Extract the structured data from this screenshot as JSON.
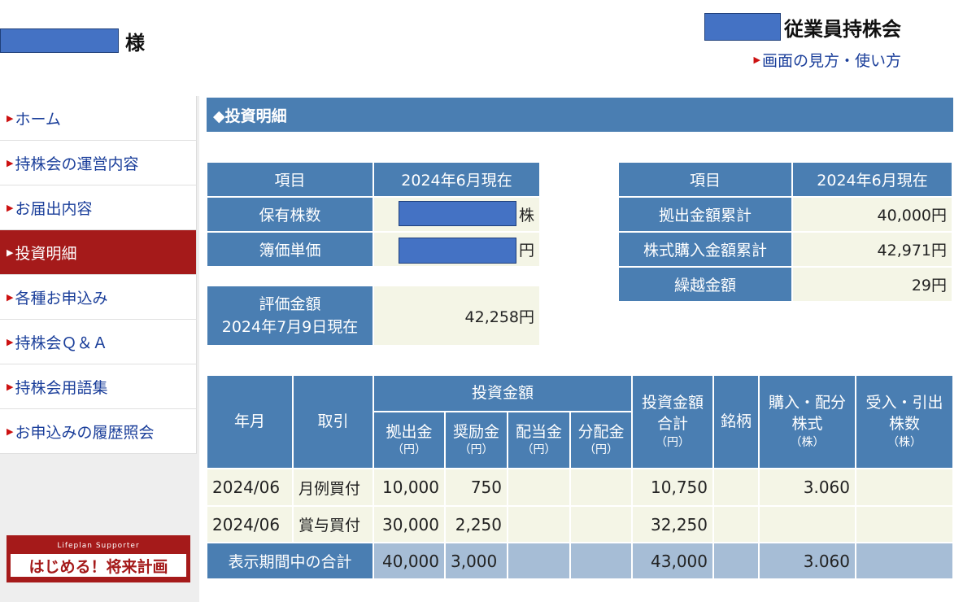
{
  "header": {
    "user_suffix": "様",
    "company_name": "従業員持株会",
    "help_link": "画面の見方・使い方"
  },
  "sidebar": {
    "items": [
      {
        "label": "ホーム"
      },
      {
        "label": "持株会の運営内容"
      },
      {
        "label": "お届出内容"
      },
      {
        "label": "投資明細"
      },
      {
        "label": "各種お申込み"
      },
      {
        "label": "持株会Ｑ＆Ａ"
      },
      {
        "label": "持株会用語集"
      },
      {
        "label": "お申込みの履歴照会"
      }
    ],
    "active_index": 3,
    "banner": {
      "small": "Lifeplan Supporter",
      "main": "はじめる！将来計画"
    }
  },
  "main": {
    "title": "◆投資明細",
    "holdings": {
      "col_item": "項目",
      "col_date": "2024年6月現在",
      "shares_label": "保有株数",
      "shares_unit": "株",
      "price_label": "簿価単価",
      "price_unit": "円"
    },
    "valuation": {
      "label_line1": "評価金額",
      "label_line2": "2024年7月9日現在",
      "value": "42,258円"
    },
    "summary": {
      "col_item": "項目",
      "col_date": "2024年6月現在",
      "rows": [
        {
          "label": "拠出金額累計",
          "value": "40,000円"
        },
        {
          "label": "株式購入金額累計",
          "value": "42,971円"
        },
        {
          "label": "繰越金額",
          "value": "29円"
        }
      ]
    },
    "detail": {
      "headers": {
        "ym": "年月",
        "trade": "取引",
        "invest": "投資金額",
        "contrib": "拠出金",
        "incentive": "奨励金",
        "dividend": "配当金",
        "distribution": "分配金",
        "yen": "（円）",
        "total_line1": "投資金額",
        "total_line2": "合計",
        "brand": "銘柄",
        "purchase_line1": "購入・配分",
        "purchase_line2": "株式",
        "transfer_line1": "受入・引出",
        "transfer_line2": "株数",
        "kabu": "（株）"
      },
      "rows": [
        {
          "ym": "2024/06",
          "trade": "月例買付",
          "contrib": "10,000",
          "incentive": "750",
          "dividend": "",
          "distribution": "",
          "total": "10,750",
          "brand": "",
          "purchase": "3.060",
          "transfer": ""
        },
        {
          "ym": "2024/06",
          "trade": "賞与買付",
          "contrib": "30,000",
          "incentive": "2,250",
          "dividend": "",
          "distribution": "",
          "total": "32,250",
          "brand": "",
          "purchase": "",
          "transfer": ""
        }
      ],
      "total": {
        "label": "表示期間中の合計",
        "contrib": "40,000",
        "incentive": "3,000",
        "dividend": "",
        "distribution": "",
        "total": "43,000",
        "brand": "",
        "purchase": "3.060",
        "transfer": ""
      }
    }
  },
  "colors": {
    "header_blue": "#4a7eb2",
    "nav_active": "#a51a1a",
    "value_bg": "#f4f5e6",
    "total_bg": "#a6bdd6",
    "redaction": "#4472c4"
  }
}
